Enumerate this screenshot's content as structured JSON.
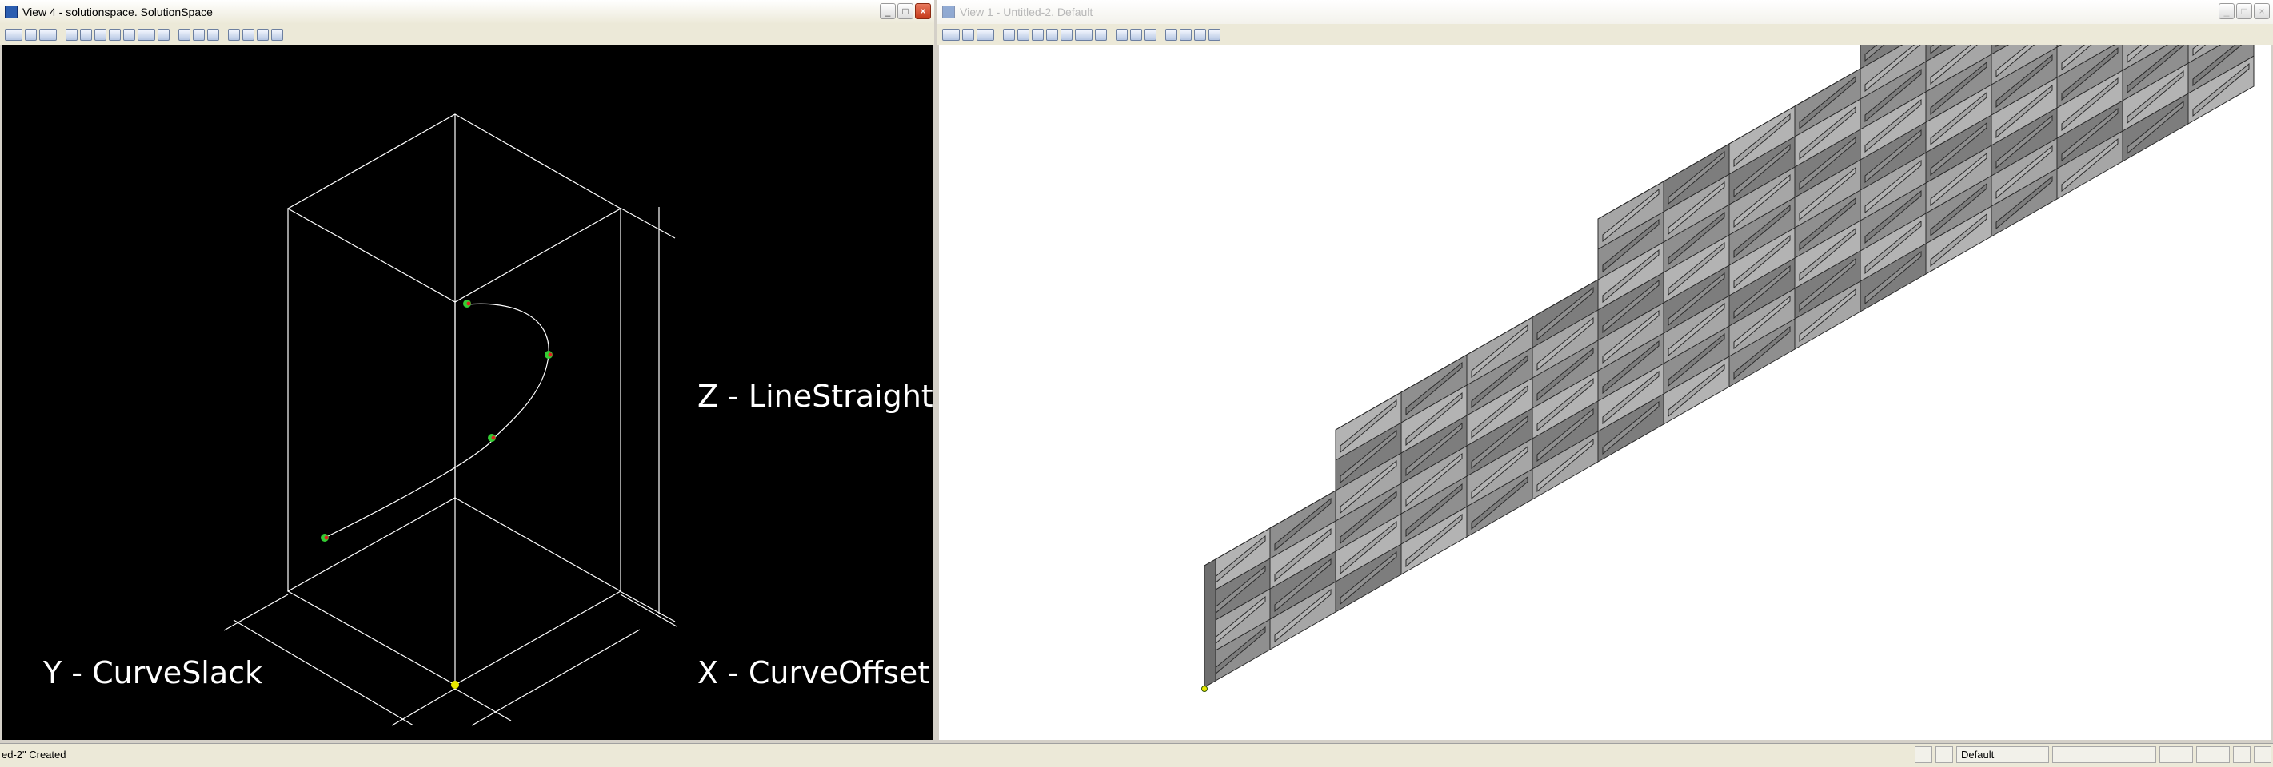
{
  "left_view": {
    "title": "View 4 - solutionspace. SolutionSpace",
    "window_buttons": [
      "minimize",
      "maximize",
      "close"
    ],
    "axis_labels": {
      "z": "Z - LineStraight",
      "y": "Y - CurveSlack",
      "x": "X - CurveOffset"
    },
    "colors": {
      "background": "#000000",
      "wire": "#ffffff",
      "point_green": "#33cc33",
      "point_red": "#dd2222",
      "origin_point": "#e8e800"
    }
  },
  "right_view": {
    "title": "View 1 - Untitled-2. Default",
    "window_buttons": [
      "minimize",
      "maximize",
      "close"
    ],
    "colors": {
      "background": "#ffffff",
      "panel_fill": "#9a9a9a",
      "edge": "#2a2a2a"
    }
  },
  "statusbar": {
    "message": "ed-2\" Created",
    "layer": "Default",
    "icons": [
      "snap-icon",
      "lock-icon"
    ]
  }
}
